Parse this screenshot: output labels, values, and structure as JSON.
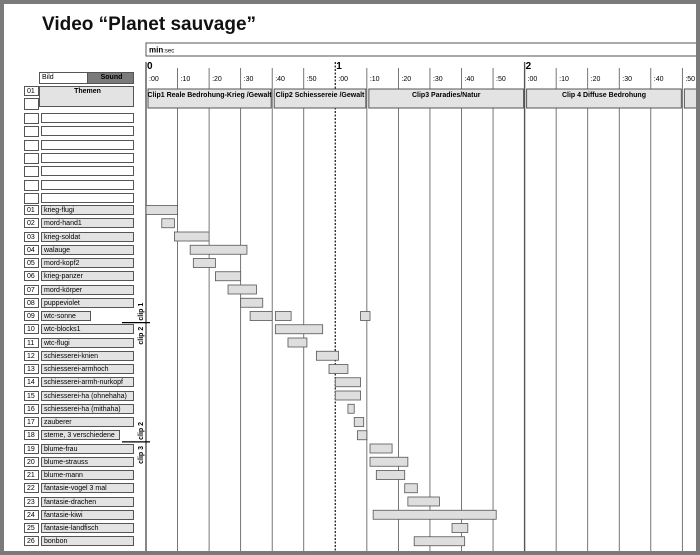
{
  "title": "Video “Planet sauvage”",
  "left_panel": {
    "bild_label": "Bild",
    "sound_label": "Sound",
    "header_num": "01",
    "header_label": "Themen",
    "clip_markers": [
      "clip 1",
      "clip 2",
      "clip 2",
      "clip 3"
    ]
  },
  "chart_data": {
    "type": "gantt",
    "axis_unit": {
      "main": "min",
      "sub": ":sec"
    },
    "minute_labels": [
      "0",
      "1",
      "2"
    ],
    "tick_labels": [
      ":00",
      ":10",
      ":20",
      ":30",
      ":40",
      ":50",
      ":00",
      ":10",
      ":20",
      ":30",
      ":40",
      ":50",
      ":00",
      ":10",
      ":20",
      ":30",
      ":40",
      ":50"
    ],
    "clips": [
      {
        "name": "Clip1 Reale Bedrohung-Krieg /Gewalt",
        "start": 0,
        "end": 40
      },
      {
        "name": "Clip2 Schiessereie /Gewalt",
        "start": 40,
        "end": 70
      },
      {
        "name": "Clip3 Paradies/Natur",
        "start": 70,
        "end": 120
      },
      {
        "name": "Clip 4  Diffuse Bedrohung",
        "start": 120,
        "end": 170
      }
    ],
    "rows": [
      {
        "num": "01",
        "label": "krieg-flugi",
        "segments": [
          [
            0,
            10
          ]
        ]
      },
      {
        "num": "02",
        "label": "mord-hand1",
        "segments": [
          [
            5,
            9
          ]
        ]
      },
      {
        "num": "03",
        "label": "krieg-soldat",
        "segments": [
          [
            9,
            20
          ]
        ]
      },
      {
        "num": "04",
        "label": "walauge",
        "segments": [
          [
            14,
            32
          ]
        ]
      },
      {
        "num": "05",
        "label": "mord-kopf2",
        "segments": [
          [
            15,
            22
          ]
        ]
      },
      {
        "num": "06",
        "label": "krieg-panzer",
        "segments": [
          [
            22,
            30
          ]
        ]
      },
      {
        "num": "07",
        "label": "mord-körper",
        "segments": [
          [
            26,
            35
          ]
        ]
      },
      {
        "num": "08",
        "label": "puppeviolet",
        "segments": [
          [
            30,
            37
          ]
        ]
      },
      {
        "num": "09",
        "label": "wtc-sonne",
        "segments": [
          [
            33,
            40
          ],
          [
            41,
            46
          ],
          [
            68,
            71
          ]
        ]
      },
      {
        "num": "10",
        "label": "wtc-blocks1",
        "segments": [
          [
            41,
            56
          ]
        ]
      },
      {
        "num": "11",
        "label": "wtc-flugi",
        "segments": [
          [
            45,
            51
          ]
        ]
      },
      {
        "num": "12",
        "label": "schiesserei-knien",
        "segments": [
          [
            54,
            61
          ]
        ]
      },
      {
        "num": "13",
        "label": "schiesserei-armhoch",
        "segments": [
          [
            58,
            64
          ]
        ]
      },
      {
        "num": "14",
        "label": "schiesserei-armh-nurkopf",
        "segments": [
          [
            60,
            68
          ]
        ]
      },
      {
        "num": "15",
        "label": "schiesserei-ha (ohnehaha)",
        "segments": [
          [
            60,
            68
          ]
        ]
      },
      {
        "num": "16",
        "label": "schiesserei-ha (mithaha)",
        "segments": [
          [
            64,
            66
          ]
        ]
      },
      {
        "num": "17",
        "label": "zauberer",
        "segments": [
          [
            66,
            69
          ]
        ]
      },
      {
        "num": "18",
        "label": "sterne, 3 verschiedene",
        "segments": [
          [
            67,
            70
          ]
        ]
      },
      {
        "num": "19",
        "label": "blume-frau",
        "segments": [
          [
            71,
            78
          ]
        ]
      },
      {
        "num": "20",
        "label": "blume-strauss",
        "segments": [
          [
            71,
            83
          ]
        ]
      },
      {
        "num": "21",
        "label": "blume-mann",
        "segments": [
          [
            73,
            82
          ]
        ]
      },
      {
        "num": "22",
        "label": "fantasie-vogel 3 mal",
        "segments": [
          [
            82,
            86
          ]
        ]
      },
      {
        "num": "23",
        "label": "fantasie-drachen",
        "segments": [
          [
            83,
            93
          ]
        ]
      },
      {
        "num": "24",
        "label": "fantasie-kiwi",
        "segments": [
          [
            72,
            111
          ]
        ]
      },
      {
        "num": "25",
        "label": "fantasie-landfisch",
        "segments": [
          [
            97,
            102
          ]
        ]
      },
      {
        "num": "26",
        "label": "bonbon",
        "segments": [
          [
            85,
            101
          ]
        ]
      }
    ],
    "xlim": [
      0,
      177
    ]
  }
}
